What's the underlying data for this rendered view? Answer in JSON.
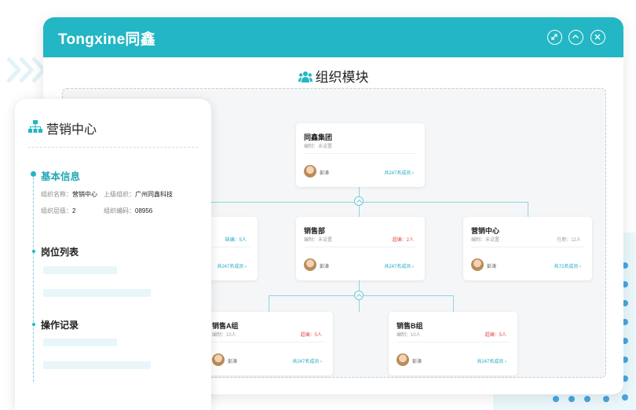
{
  "brand": {
    "logo": "Tongxine同鑫"
  },
  "module": {
    "title": "组织模块"
  },
  "org": {
    "root": {
      "name": "同鑫集团",
      "sub": "编制：未设置",
      "person": "彭涛",
      "members": "共247名成员"
    },
    "level2": [
      {
        "name": "",
        "sub": "",
        "badge": "缺编：5人",
        "person": "",
        "members": "共247名成员"
      },
      {
        "name": "销售部",
        "sub": "编制：未设置",
        "badge": "超编：2人",
        "person": "彭涛",
        "members": "共247名成员"
      },
      {
        "name": "营销中心",
        "sub": "编制：未设置",
        "badge": "在职：12人",
        "person": "彭涛",
        "members": "共72名成员"
      }
    ],
    "level3": [
      {
        "name": "销售A组",
        "sub": "编制：10人",
        "badge": "超编：5人",
        "person": "彭涛",
        "members": "共247名成员"
      },
      {
        "name": "销售B组",
        "sub": "编制：10人",
        "badge": "超编：5人",
        "person": "彭涛",
        "members": "共247名成员"
      }
    ]
  },
  "side": {
    "title": "营销中心",
    "basic_title": "基本信息",
    "org_name_label": "组织名称：",
    "org_name": "营销中心",
    "parent_label": "上级组织：",
    "parent": "广州同鑫科技",
    "level_label": "组织层级：",
    "level": "2",
    "code_label": "组织编码：",
    "code": "08956",
    "positions_title": "岗位列表",
    "records_title": "操作记录"
  },
  "colors": {
    "accent": "#23b6c4",
    "link": "#23a8c8",
    "danger": "#e84a4a"
  }
}
